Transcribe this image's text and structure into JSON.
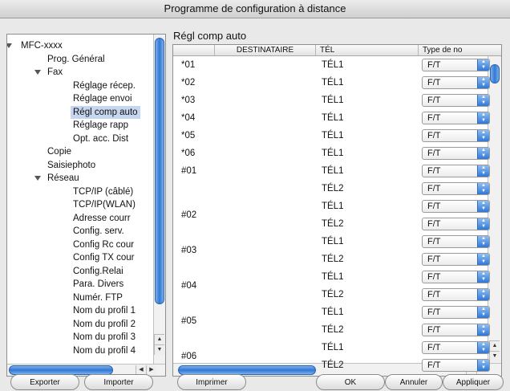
{
  "window": {
    "title": "Programme de configuration à distance"
  },
  "tree": {
    "items": [
      {
        "label": "MFC-xxxx",
        "level": 0,
        "expanded": true
      },
      {
        "label": "Prog. Général",
        "level": 1
      },
      {
        "label": "Fax",
        "level": 1,
        "expanded": true
      },
      {
        "label": "Réglage récep.",
        "level": 2
      },
      {
        "label": "Réglage envoi",
        "level": 2
      },
      {
        "label": "Régl comp auto",
        "level": 2,
        "selected": true
      },
      {
        "label": "Réglage rapp",
        "level": 2
      },
      {
        "label": "Opt. acc. Dist",
        "level": 2
      },
      {
        "label": "Copie",
        "level": 1
      },
      {
        "label": "Saisiephoto",
        "level": 1
      },
      {
        "label": "Réseau",
        "level": 1,
        "expanded": true
      },
      {
        "label": "TCP/IP (câblé)",
        "level": 2
      },
      {
        "label": "TCP/IP(WLAN)",
        "level": 2
      },
      {
        "label": "Adresse courr",
        "level": 2
      },
      {
        "label": "Config. serv.",
        "level": 2
      },
      {
        "label": "Config Rc cour",
        "level": 2
      },
      {
        "label": "Config TX cour",
        "level": 2
      },
      {
        "label": "Config.Relai",
        "level": 2
      },
      {
        "label": "Para. Divers",
        "level": 2
      },
      {
        "label": "Numér. FTP",
        "level": 2
      },
      {
        "label": "Nom du profil 1",
        "level": 2
      },
      {
        "label": "Nom du profil 2",
        "level": 2
      },
      {
        "label": "Nom du profil 3",
        "level": 2
      },
      {
        "label": "Nom du profil 4",
        "level": 2
      }
    ]
  },
  "panel": {
    "title": "Régl comp auto",
    "columns": [
      "",
      "DESTINATAIRE",
      "TÉL",
      "Type de no"
    ],
    "rows": [
      {
        "id": "*01",
        "tel": "TÉL1",
        "type": "F/T"
      },
      {
        "id": "*02",
        "tel": "TÉL1",
        "type": "F/T"
      },
      {
        "id": "*03",
        "tel": "TÉL1",
        "type": "F/T"
      },
      {
        "id": "*04",
        "tel": "TÉL1",
        "type": "F/T"
      },
      {
        "id": "*05",
        "tel": "TÉL1",
        "type": "F/T"
      },
      {
        "id": "*06",
        "tel": "TÉL1",
        "type": "F/T"
      },
      {
        "id": "#01",
        "tel": "TÉL1",
        "type": "F/T"
      },
      {
        "id": "",
        "tel": "TÉL2",
        "type": "F/T"
      },
      {
        "id": "#02",
        "tel": "TÉL1",
        "type": "F/T"
      },
      {
        "id": "",
        "tel": "TÉL2",
        "type": "F/T"
      },
      {
        "id": "#03",
        "tel": "TÉL1",
        "type": "F/T"
      },
      {
        "id": "",
        "tel": "TÉL2",
        "type": "F/T"
      },
      {
        "id": "#04",
        "tel": "TÉL1",
        "type": "F/T"
      },
      {
        "id": "",
        "tel": "TÉL2",
        "type": "F/T"
      },
      {
        "id": "#05",
        "tel": "TÉL1",
        "type": "F/T"
      },
      {
        "id": "",
        "tel": "TÉL2",
        "type": "F/T"
      },
      {
        "id": "#06",
        "tel": "TÉL1",
        "type": "F/T"
      },
      {
        "id": "",
        "tel": "TÉL2",
        "type": "F/T"
      }
    ]
  },
  "buttons": {
    "export": "Exporter",
    "import": "Importer",
    "print": "Imprimer",
    "ok": "OK",
    "cancel": "Annuler",
    "apply": "Appliquer"
  },
  "icons": {
    "stepper": "up-down-stepper-icon",
    "disclosure": "disclosure-triangle-icon"
  }
}
